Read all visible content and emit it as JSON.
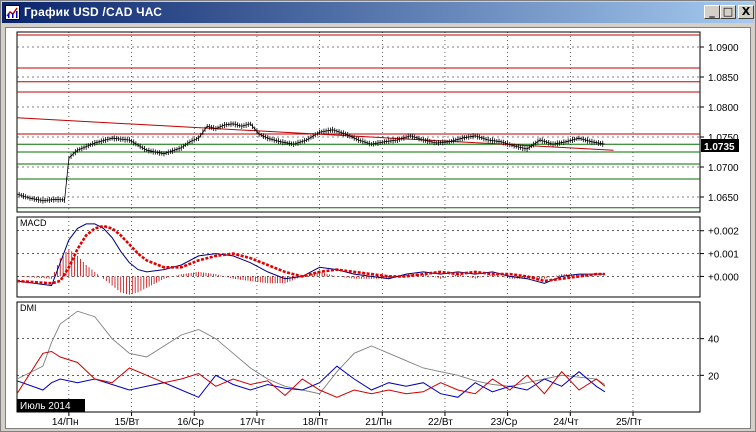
{
  "window": {
    "title": "График USD /CAD  ЧАС",
    "minimize_label": "_",
    "maximize_label": "□",
    "close_label": "X"
  },
  "colors": {
    "grid": "#000000",
    "resistance": "#c00000",
    "support": "#007000",
    "price": "#000000",
    "trendline": "#c00000",
    "macd_line": "#000080",
    "signal": "#e00000",
    "histogram": "#c00000",
    "adx": "#808080",
    "di_plus": "#0000c0",
    "di_minus": "#d00000",
    "current_price_bg": "#000000"
  },
  "chart_data": [
    {
      "type": "line",
      "name": "price",
      "current_price": "1.0735",
      "yticks": [
        "1.0900",
        "1.0850",
        "1.0800",
        "1.0750",
        "1.0700",
        "1.0650"
      ],
      "ylim": [
        1.0625,
        1.0925
      ],
      "red_levels": [
        1.092,
        1.0865,
        1.0842,
        1.0825,
        1.0755
      ],
      "green_levels": [
        1.0738,
        1.0725,
        1.0705,
        1.068,
        1.0632
      ],
      "trendline": [
        [
          0,
          1.0782
        ],
        [
          138,
          1.0728
        ]
      ],
      "x": [
        0,
        3,
        6,
        9,
        11,
        12,
        14,
        18,
        22,
        26,
        30,
        34,
        38,
        40,
        42,
        44,
        46,
        48,
        50,
        52,
        54,
        56,
        58,
        61,
        64,
        67,
        70,
        73,
        76,
        79,
        82,
        85,
        88,
        91,
        94,
        97,
        100,
        103,
        106,
        109,
        112,
        115,
        118,
        121,
        124,
        127,
        130,
        133,
        136
      ],
      "values": [
        1.0655,
        1.0648,
        1.0644,
        1.0646,
        1.0645,
        1.0715,
        1.0728,
        1.074,
        1.0748,
        1.0745,
        1.0728,
        1.0722,
        1.0732,
        1.0742,
        1.0748,
        1.0768,
        1.0764,
        1.077,
        1.0772,
        1.0768,
        1.0772,
        1.0755,
        1.0748,
        1.0742,
        1.0738,
        1.0745,
        1.0758,
        1.0762,
        1.0755,
        1.0745,
        1.0738,
        1.0742,
        1.0745,
        1.0752,
        1.0745,
        1.074,
        1.0742,
        1.0748,
        1.0752,
        1.0745,
        1.0742,
        1.0735,
        1.073,
        1.0745,
        1.0738,
        1.0742,
        1.0748,
        1.0742,
        1.0738
      ]
    },
    {
      "type": "line",
      "name": "MACD",
      "label": "MACD",
      "yticks": [
        "+0.002",
        "+0.001",
        "+0.000"
      ],
      "ylim": [
        -0.0009,
        0.0026
      ],
      "x": [
        0,
        8,
        10,
        12,
        14,
        16,
        18,
        20,
        22,
        24,
        26,
        28,
        30,
        34,
        38,
        42,
        46,
        50,
        54,
        58,
        62,
        66,
        70,
        74,
        78,
        82,
        86,
        90,
        94,
        98,
        102,
        106,
        110,
        114,
        118,
        122,
        126,
        130,
        134,
        136
      ],
      "macd": [
        -0.0002,
        -0.0004,
        0.0006,
        0.0016,
        0.0021,
        0.0023,
        0.0023,
        0.0021,
        0.0017,
        0.0011,
        0.0006,
        0.0003,
        0.0002,
        0.0003,
        0.0005,
        0.0009,
        0.001,
        0.0009,
        0.0006,
        0.0002,
        -0.0001,
        0.0,
        0.0004,
        0.0003,
        0.0001,
        0.0,
        -0.0001,
        0.0001,
        0.0002,
        0.0001,
        0.0002,
        0.0001,
        0.0002,
        0.0,
        -0.0001,
        -0.0003,
        0.0,
        0.0001,
        0.0001,
        0.0001
      ],
      "signal": [
        -0.0002,
        -0.0003,
        -0.0002,
        0.0004,
        0.0012,
        0.0018,
        0.0021,
        0.0022,
        0.0021,
        0.0018,
        0.0014,
        0.001,
        0.0007,
        0.0004,
        0.0004,
        0.0007,
        0.0009,
        0.001,
        0.0008,
        0.0005,
        0.0002,
        0.0,
        0.0002,
        0.0003,
        0.0002,
        0.0001,
        0.0,
        0.0,
        0.0001,
        0.0002,
        0.0001,
        0.0002,
        0.0001,
        0.0001,
        0.0,
        -0.0002,
        -0.0001,
        0.0,
        0.0001,
        0.0001
      ],
      "histogram": [
        0.0,
        -0.0001,
        0.0008,
        0.0012,
        0.0009,
        0.0005,
        0.0002,
        -0.0001,
        -0.0004,
        -0.0007,
        -0.0008,
        -0.0007,
        -0.0005,
        -0.0001,
        0.0001,
        0.0002,
        0.0001,
        -0.0001,
        -0.0002,
        -0.0003,
        -0.0003,
        0.0,
        0.0002,
        0.0,
        -0.0001,
        -0.0001,
        -0.0001,
        0.0001,
        0.0001,
        -0.0001,
        0.0001,
        -0.0001,
        0.0001,
        -0.0001,
        -0.0001,
        -0.0001,
        0.0001,
        0.0001,
        0.0,
        0.0
      ]
    },
    {
      "type": "line",
      "name": "DMI",
      "label": "DMI",
      "yticks": [
        "40",
        "20"
      ],
      "ylim": [
        0,
        60
      ],
      "x": [
        0,
        6,
        8,
        10,
        14,
        18,
        22,
        26,
        30,
        34,
        38,
        42,
        46,
        50,
        54,
        58,
        62,
        66,
        70,
        74,
        78,
        82,
        86,
        90,
        94,
        98,
        102,
        106,
        110,
        114,
        118,
        122,
        126,
        130,
        134,
        136
      ],
      "adx": [
        18,
        25,
        38,
        48,
        55,
        52,
        40,
        32,
        30,
        36,
        42,
        45,
        40,
        32,
        24,
        18,
        14,
        12,
        10,
        22,
        32,
        36,
        32,
        28,
        24,
        22,
        20,
        17,
        15,
        14,
        16,
        18,
        20,
        19,
        18,
        15
      ],
      "di_plus": [
        17,
        12,
        16,
        18,
        16,
        18,
        15,
        12,
        14,
        16,
        12,
        8,
        20,
        15,
        12,
        15,
        13,
        12,
        16,
        25,
        18,
        12,
        16,
        14,
        16,
        10,
        8,
        16,
        11,
        14,
        12,
        18,
        14,
        22,
        14,
        11
      ],
      "di_minus": [
        10,
        32,
        33,
        30,
        27,
        18,
        16,
        24,
        20,
        16,
        18,
        21,
        14,
        18,
        15,
        17,
        9,
        18,
        12,
        8,
        12,
        10,
        12,
        10,
        11,
        16,
        12,
        10,
        18,
        12,
        20,
        10,
        22,
        12,
        18,
        14
      ]
    }
  ],
  "x_axis": {
    "range": [
      0,
      158
    ],
    "month_label": "Июль 2014",
    "ticks": [
      {
        "pos": 12,
        "label": "14/Пн"
      },
      {
        "pos": 26.5,
        "label": "15/Вт"
      },
      {
        "pos": 41,
        "label": "16/Ср"
      },
      {
        "pos": 55.5,
        "label": "17/Чт"
      },
      {
        "pos": 70,
        "label": "18/Пт"
      },
      {
        "pos": 84.5,
        "label": "21/Пн"
      },
      {
        "pos": 99,
        "label": "22/Вт"
      },
      {
        "pos": 113.5,
        "label": "23/Ср"
      },
      {
        "pos": 128,
        "label": "24/Чт"
      },
      {
        "pos": 142.5,
        "label": "25/Пт"
      }
    ]
  }
}
